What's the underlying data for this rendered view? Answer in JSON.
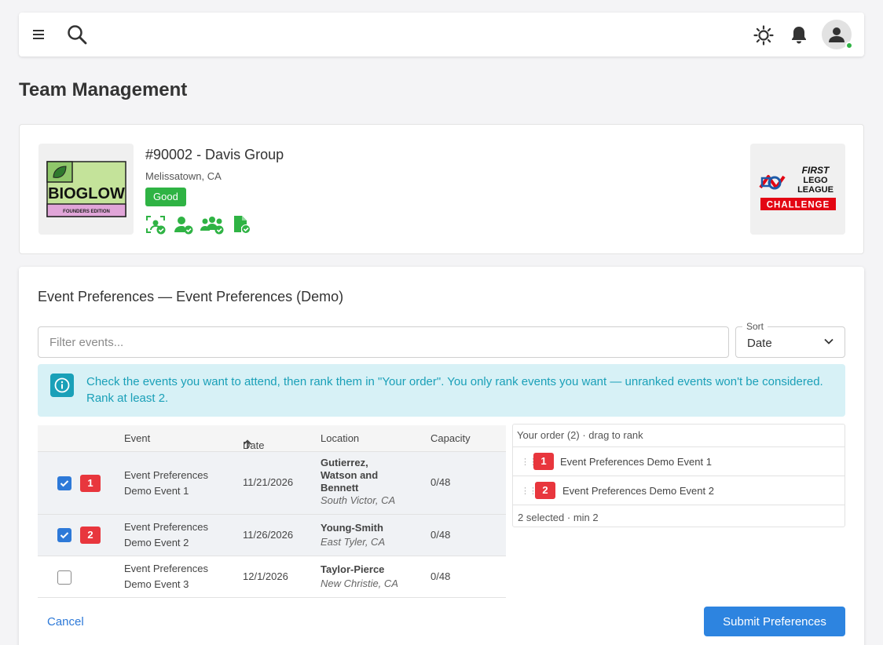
{
  "topbar": {
    "icons": [
      "menu-icon",
      "search-icon",
      "sun-icon",
      "bell-icon",
      "user-icon"
    ]
  },
  "page_title": "Team Management",
  "team": {
    "name": "#90002 - Davis Group",
    "location": "Melissatown, CA",
    "status": "Good",
    "logo_text": "BIOGLOW",
    "logo_subtext": "FOUNDERS EDITION",
    "program_logo": {
      "line1": "FIRST",
      "line2": "LEGO",
      "line3": "LEAGUE",
      "line4": "CHALLENGE"
    },
    "colors": {
      "good": "#2fb344",
      "challenge_red": "#e30613"
    }
  },
  "prefs": {
    "title": "Event Preferences — Event Preferences (Demo)",
    "filter_placeholder": "Filter events...",
    "sort_label": "Sort",
    "sort_value": "Date",
    "info": "Check the events you want to attend, then rank them in \"Your order\". You only rank events you want — unranked events won't be considered. Rank at least 2.",
    "columns": {
      "event": "Event",
      "date": "Date",
      "location": "Location",
      "capacity": "Capacity"
    },
    "rows": [
      {
        "checked": true,
        "rank": "1",
        "event_line1": "Event Preferences",
        "event_line2": "Demo Event 1",
        "date": "11/21/2026",
        "loc_line1": "Gutierrez,",
        "loc_line2": "Watson and",
        "loc_line3": "Bennett",
        "city": "South Victor, CA",
        "capacity": "0/48"
      },
      {
        "checked": true,
        "rank": "2",
        "event_line1": "Event Preferences",
        "event_line2": "Demo Event 2",
        "date": "11/26/2026",
        "loc_line1": "Young-Smith",
        "city": "East Tyler, CA",
        "capacity": "0/48"
      },
      {
        "checked": false,
        "event_line1": "Event Preferences",
        "event_line2": "Demo Event 3",
        "date": "12/1/2026",
        "loc_line1": "Taylor-Pierce",
        "city": "New Christie, CA",
        "capacity": "0/48"
      }
    ],
    "order": {
      "header": "Your order (2) · drag to rank",
      "items": [
        {
          "rank": "1",
          "label": "Event Preferences Demo Event 1"
        },
        {
          "rank": "2",
          "label": "Event Preferences Demo Event 2"
        }
      ],
      "footer": "2 selected · min 2"
    },
    "cancel": "Cancel",
    "submit": "Submit Preferences"
  }
}
